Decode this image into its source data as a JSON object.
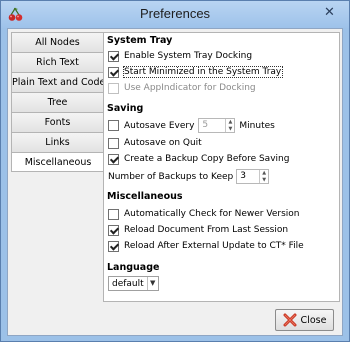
{
  "window": {
    "title": "Preferences",
    "close_glyph": "✕",
    "app_icon": "cherry-icon"
  },
  "tabs": [
    {
      "label": "All Nodes"
    },
    {
      "label": "Rich Text"
    },
    {
      "label": "Plain Text and Code"
    },
    {
      "label": "Tree"
    },
    {
      "label": "Fonts"
    },
    {
      "label": "Links"
    },
    {
      "label": "Miscellaneous"
    }
  ],
  "system_tray": {
    "title": "System Tray",
    "enable_docking": {
      "label": "Enable System Tray Docking",
      "checked": true
    },
    "start_minimized": {
      "label": "Start Minimized in the System Tray",
      "checked": true
    },
    "use_appindicator": {
      "label": "Use AppIndicator for Docking",
      "checked": false,
      "enabled": false
    }
  },
  "saving": {
    "title": "Saving",
    "autosave": {
      "label": "Autosave Every",
      "checked": false,
      "value": "5",
      "unit": "Minutes"
    },
    "autosave_on_quit": {
      "label": "Autosave on Quit",
      "checked": false
    },
    "backup_copy": {
      "label": "Create a Backup Copy Before Saving",
      "checked": true
    },
    "backups_to_keep": {
      "label": "Number of Backups to Keep",
      "value": "3"
    }
  },
  "miscellaneous": {
    "title": "Miscellaneous",
    "check_version": {
      "label": "Automatically Check for Newer Version",
      "checked": false
    },
    "reload_session": {
      "label": "Reload Document From Last Session",
      "checked": true
    },
    "reload_after_update": {
      "label": "Reload After External Update to CT* File",
      "checked": true
    }
  },
  "language": {
    "title": "Language",
    "value": "default"
  },
  "footer": {
    "close_label": "Close"
  },
  "colors": {
    "titlebar": "#9ec2ea",
    "close_icon_red": "#c8321e"
  }
}
